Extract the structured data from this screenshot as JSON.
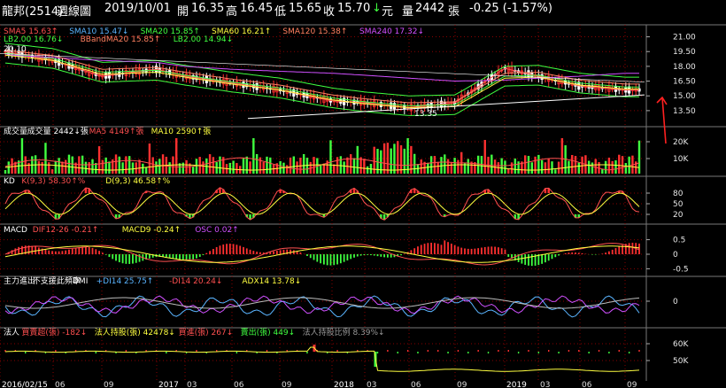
{
  "header": {
    "stock": "龍邦(2514)",
    "period": "週線圖",
    "date": "2019/10/01",
    "open_label": "開",
    "open": "16.35",
    "high_label": "高",
    "high": "16.45",
    "low_label": "低",
    "low": "15.65",
    "close_arrow": "↓",
    "close": "15.70",
    "close_unit": "元",
    "vol_label": "量",
    "vol": "2442",
    "vol_unit": "張",
    "change": "-0.25 (-1.57%)"
  },
  "colors": {
    "up": "#ff3030",
    "down": "#ffffff",
    "ma5": "#ff5050",
    "ma10": "#5ab4ff",
    "ma20": "#40ff40",
    "ma60": "#ffff40",
    "ma120": "#ff8060",
    "ma240": "#d050ff",
    "grid": "#8a0000",
    "annotation": "#ff2020"
  },
  "panels": {
    "price": {
      "legend": [
        {
          "text": "SMA5 15.63↑",
          "color": "#ff5050"
        },
        {
          "text": "SMA10 15.47↓",
          "color": "#5ab4ff"
        },
        {
          "text": "SMA20 15.85↑",
          "color": "#40ff40"
        },
        {
          "text": "SMA60 16.21↑",
          "color": "#ffff40"
        },
        {
          "text": "SMA120 15.38↑",
          "color": "#ff8060"
        },
        {
          "text": "SMA240 17.32↓",
          "color": "#d050ff"
        }
      ],
      "legend2": [
        {
          "text": "LB2.00 16.76↓",
          "color": "#40ff40"
        },
        {
          "text": "BBandMA20 15.85↑",
          "color": "#ff8060"
        },
        {
          "text": "LB2.00 14.94↓",
          "color": "#40ff40"
        }
      ],
      "max_label": "20.10",
      "min_label": "13.35",
      "ticks": [
        "21.00",
        "19.50",
        "18.00",
        "16.50",
        "15.00",
        "13.50"
      ]
    },
    "volume": {
      "legend": [
        {
          "text": "成交量",
          "color": "#ffffff"
        },
        {
          "text": "成交量 2442↓張",
          "color": "#ffffff"
        },
        {
          "text": "MA5 4149↑張",
          "color": "#ff5050"
        },
        {
          "text": "MA10 2590↑張",
          "color": "#ffff40"
        }
      ],
      "ticks": [
        "20K",
        "10K"
      ]
    },
    "kd": {
      "legend": [
        {
          "text": "KD",
          "color": "#ffffff"
        },
        {
          "text": "K(9,3) 58.30↑%",
          "color": "#ff5050"
        },
        {
          "text": "D(9,3) 46.58↑%",
          "color": "#ffff40"
        }
      ],
      "ticks": [
        "80",
        "50",
        "20"
      ]
    },
    "macd": {
      "legend": [
        {
          "text": "MACD",
          "color": "#ffffff"
        },
        {
          "text": "DIF12-26 -0.21↑",
          "color": "#ff5050"
        },
        {
          "text": "MACD9 -0.24↑",
          "color": "#ffff40"
        },
        {
          "text": "OSC 0.02↑",
          "color": "#d050ff"
        }
      ],
      "ticks": [
        "0.5",
        "0",
        "-0.5"
      ]
    },
    "dmi": {
      "legend": [
        {
          "text": "主力進出",
          "color": "#ffffff"
        },
        {
          "text": "不支援此頻率",
          "color": "#ffffff"
        },
        {
          "text": "DMI",
          "color": "#ffffff"
        },
        {
          "text": "+DI14 25.75↑",
          "color": "#5ab4ff"
        },
        {
          "text": "-DI14 20.24↓",
          "color": "#ff5050"
        },
        {
          "text": "ADX14 13.78↓",
          "color": "#ffff40"
        }
      ],
      "ticks": [
        "0"
      ]
    },
    "inst": {
      "legend": [
        {
          "text": "法人",
          "color": "#ffffff"
        },
        {
          "text": "買賣超(張) -182↓",
          "color": "#ff5050"
        },
        {
          "text": "法人持股(張) 42478↓",
          "color": "#ffff40"
        },
        {
          "text": "買進(張) 267↓",
          "color": "#ff5050"
        },
        {
          "text": "賣出(張) 449↓",
          "color": "#40ff40"
        },
        {
          "text": "法人持股比例 8.39%↓",
          "color": "#999999"
        }
      ],
      "ticks": [
        "60K",
        "50K"
      ]
    }
  },
  "xaxis": [
    "2016/02/15",
    "06",
    "09",
    "2017",
    "03",
    "06",
    "09",
    "2018",
    "03",
    "06",
    "09",
    "2019",
    "03",
    "06",
    "09"
  ],
  "chart_data": {
    "type": "line",
    "title": "龍邦(2514) 週線圖",
    "x": [
      "2016/02/15",
      "2016/06",
      "2016/09",
      "2017",
      "2017/03",
      "2017/06",
      "2017/09",
      "2018",
      "2018/03",
      "2018/06",
      "2018/09",
      "2019",
      "2019/03",
      "2019/06",
      "2019/09"
    ],
    "ylim": [
      12.5,
      21.5
    ],
    "series": [
      {
        "name": "SMA5",
        "values": [
          19.6,
          18.6,
          17.0,
          17.7,
          17.0,
          16.3,
          15.6,
          14.5,
          14.3,
          13.8,
          14.3,
          17.8,
          17.0,
          16.0,
          15.6
        ]
      },
      {
        "name": "SMA20",
        "values": [
          19.4,
          18.8,
          17.4,
          17.6,
          17.1,
          16.4,
          15.8,
          14.8,
          14.4,
          14.0,
          14.1,
          17.0,
          17.1,
          16.3,
          15.9
        ]
      },
      {
        "name": "SMA240",
        "values": [
          19.2,
          18.9,
          18.6,
          18.4,
          18.0,
          17.7,
          17.5,
          17.3,
          17.1,
          16.8,
          16.5,
          16.6,
          16.8,
          17.0,
          17.3
        ]
      },
      {
        "name": "成交量",
        "values": [
          5000,
          4000,
          3500,
          7000,
          6000,
          4000,
          5000,
          8000,
          6000,
          3000,
          4000,
          12000,
          5000,
          4000,
          2442
        ]
      }
    ],
    "annotations": [
      "20.10",
      "13.35"
    ]
  }
}
